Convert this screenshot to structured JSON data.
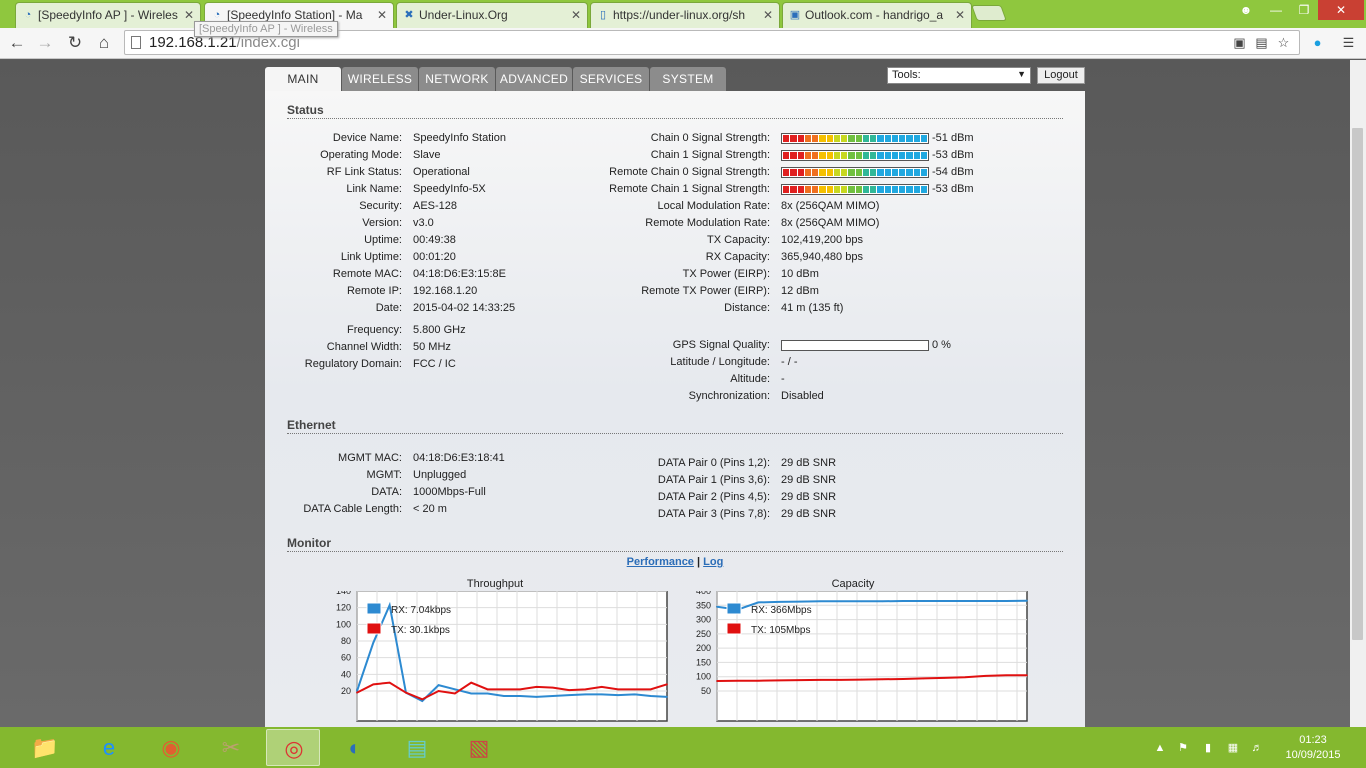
{
  "browser": {
    "tabs": [
      {
        "label": "[SpeedyInfo AP ] - Wireles",
        "icon": "wifi-icon",
        "active": false
      },
      {
        "label": "[SpeedyInfo Station] - Ma",
        "icon": "wifi-icon",
        "active": true
      },
      {
        "label": "Under-Linux.Org",
        "icon": "x-logo-icon",
        "active": false
      },
      {
        "label": "https://under-linux.org/sh",
        "icon": "page-icon",
        "active": false
      },
      {
        "label": "Outlook.com - handrigo_a",
        "icon": "outlook-icon",
        "active": false
      }
    ],
    "url_host": "192.168.1.21",
    "url_path": "/index.cgi",
    "tooltip": "[SpeedyInfo AP ] - Wireless"
  },
  "ubnt": {
    "nav_tabs": [
      "MAIN",
      "WIRELESS",
      "NETWORK",
      "ADVANCED",
      "SERVICES",
      "SYSTEM"
    ],
    "tools_label": "Tools:",
    "logout_label": "Logout",
    "status_title": "Status",
    "status_left": [
      {
        "label": "Device Name:",
        "value": "SpeedyInfo Station"
      },
      {
        "label": "Operating Mode:",
        "value": "Slave"
      },
      {
        "label": "RF Link Status:",
        "value": "Operational"
      },
      {
        "label": "Link Name:",
        "value": "SpeedyInfo-5X"
      },
      {
        "label": "Security:",
        "value": "AES-128"
      },
      {
        "label": "Version:",
        "value": "v3.0"
      },
      {
        "label": "Uptime:",
        "value": "00:49:38"
      },
      {
        "label": "Link Uptime:",
        "value": "00:01:20"
      },
      {
        "label": "Remote MAC:",
        "value": "04:18:D6:E3:15:8E"
      },
      {
        "label": "Remote IP:",
        "value": "192.168.1.20"
      },
      {
        "label": "Date:",
        "value": "2015-04-02 14:33:25"
      }
    ],
    "status_left2": [
      {
        "label": "Frequency:",
        "value": "5.800 GHz"
      },
      {
        "label": "Channel Width:",
        "value": "50 MHz"
      },
      {
        "label": "Regulatory Domain:",
        "value": "FCC / IC"
      }
    ],
    "signal_rows": [
      {
        "label": "Chain 0 Signal Strength:",
        "value": "-51 dBm",
        "level": 1.0
      },
      {
        "label": "Chain 1 Signal Strength:",
        "value": "-53 dBm",
        "level": 1.0
      },
      {
        "label": "Remote Chain 0 Signal Strength:",
        "value": "-54 dBm",
        "level": 1.0
      },
      {
        "label": "Remote Chain 1 Signal Strength:",
        "value": "-53 dBm",
        "level": 1.0
      }
    ],
    "status_right": [
      {
        "label": "Local Modulation Rate:",
        "value": "8x (256QAM MIMO)"
      },
      {
        "label": "Remote Modulation Rate:",
        "value": "8x (256QAM MIMO)"
      },
      {
        "label": "TX Capacity:",
        "value": "102,419,200 bps"
      },
      {
        "label": "RX Capacity:",
        "value": "365,940,480 bps"
      },
      {
        "label": "TX Power (EIRP):",
        "value": "10 dBm"
      },
      {
        "label": "Remote TX Power (EIRP):",
        "value": "12 dBm"
      },
      {
        "label": "Distance:",
        "value": "41 m (135 ft)"
      }
    ],
    "gps": {
      "label": "GPS Signal Quality:",
      "value": "0 %",
      "level": 0
    },
    "status_right2": [
      {
        "label": "Latitude / Longitude:",
        "value": "- / -"
      },
      {
        "label": "Altitude:",
        "value": "-"
      },
      {
        "label": "Synchronization:",
        "value": "Disabled"
      }
    ],
    "ethernet_title": "Ethernet",
    "ethernet_left": [
      {
        "label": "MGMT MAC:",
        "value": "04:18:D6:E3:18:41"
      },
      {
        "label": "MGMT:",
        "value": "Unplugged"
      },
      {
        "label": "DATA:",
        "value": "1000Mbps-Full"
      },
      {
        "label": "DATA Cable Length:",
        "value": "< 20 m"
      }
    ],
    "ethernet_right": [
      {
        "label": "DATA Pair 0 (Pins 1,2):",
        "value": "29 dB SNR"
      },
      {
        "label": "DATA Pair 1 (Pins 3,6):",
        "value": "29 dB SNR"
      },
      {
        "label": "DATA Pair 2 (Pins 4,5):",
        "value": "29 dB SNR"
      },
      {
        "label": "DATA Pair 3 (Pins 7,8):",
        "value": "29 dB SNR"
      }
    ],
    "monitor_title": "Monitor",
    "monitor_links": {
      "performance": "Performance",
      "sep": "|",
      "log": "Log"
    }
  },
  "chart_data": [
    {
      "type": "line",
      "title": "Throughput",
      "ylim": [
        20,
        140
      ],
      "yticks": [
        140,
        120,
        100,
        80,
        60,
        40,
        20
      ],
      "series": [
        {
          "name": "RX: 7.04kbps",
          "color": "#2d8ad1",
          "values": [
            20,
            78,
            123,
            18,
            8,
            27,
            22,
            17,
            17,
            14,
            14,
            13,
            14,
            15,
            16,
            16,
            15,
            16,
            14,
            13
          ]
        },
        {
          "name": "TX: 30.1kbps",
          "color": "#e01010",
          "values": [
            18,
            28,
            30,
            18,
            10,
            20,
            17,
            30,
            22,
            22,
            22,
            25,
            24,
            21,
            22,
            25,
            22,
            22,
            22,
            28
          ]
        }
      ]
    },
    {
      "type": "line",
      "title": "Capacity",
      "ylim": [
        50,
        400
      ],
      "yticks": [
        400,
        350,
        300,
        250,
        200,
        150,
        100,
        50
      ],
      "series": [
        {
          "name": "RX: 366Mbps",
          "color": "#2d8ad1",
          "values": [
            345,
            335,
            360,
            362,
            363,
            364,
            364,
            364,
            364,
            365,
            365,
            365,
            365,
            365,
            365,
            366
          ]
        },
        {
          "name": "TX: 105Mbps",
          "color": "#e01010",
          "values": [
            85,
            86,
            86,
            87,
            88,
            89,
            89,
            90,
            91,
            92,
            94,
            96,
            98,
            103,
            105,
            105
          ]
        }
      ]
    }
  ],
  "taskbar": {
    "icons": [
      "file-explorer-icon",
      "internet-explorer-icon",
      "colorful-app-icon",
      "scanner-app-icon",
      "chrome-icon",
      "app-circle-icon",
      "note-app-icon",
      "paint-app-icon"
    ],
    "time": "01:23",
    "date": "10/09/2015"
  }
}
